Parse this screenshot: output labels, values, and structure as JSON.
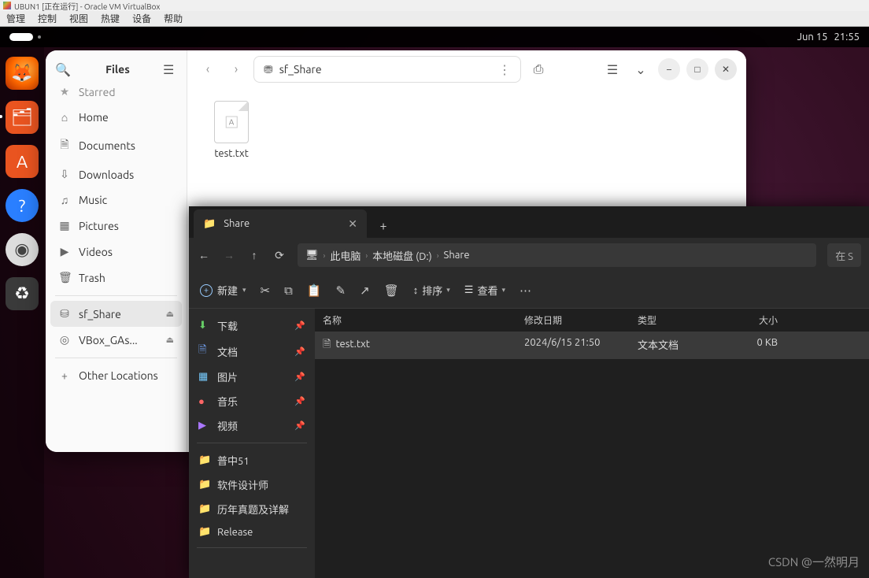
{
  "vbox": {
    "title": "UBUN1 [正在运行] - Oracle VM VirtualBox",
    "menu": [
      "管理",
      "控制",
      "视图",
      "热键",
      "设备",
      "帮助"
    ]
  },
  "topbar": {
    "date": "Jun 15",
    "time": "21:55"
  },
  "nautilus": {
    "sidebar_title": "Files",
    "path_label": "sf_Share",
    "sidebar": [
      {
        "icon": "★",
        "label": "Starred"
      },
      {
        "icon": "⌂",
        "label": "Home"
      },
      {
        "icon": "🗎",
        "label": "Documents"
      },
      {
        "icon": "⇩",
        "label": "Downloads"
      },
      {
        "icon": "♫",
        "label": "Music"
      },
      {
        "icon": "▦",
        "label": "Pictures"
      },
      {
        "icon": "▶",
        "label": "Videos"
      },
      {
        "icon": "🗑",
        "label": "Trash"
      }
    ],
    "mounts": [
      {
        "icon": "⛁",
        "label": "sf_Share",
        "selected": true
      },
      {
        "icon": "◎",
        "label": "VBox_GAs..."
      }
    ],
    "other_locations": "Other Locations",
    "files": [
      {
        "name": "test.txt"
      }
    ]
  },
  "winexp": {
    "tab_title": "Share",
    "breadcrumb": [
      "此电脑",
      "本地磁盘 (D:)",
      "Share"
    ],
    "search_placeholder": "在 S",
    "new_label": "新建",
    "sort_label": "排序",
    "view_label": "查看",
    "columns": {
      "name": "名称",
      "date": "修改日期",
      "type": "类型",
      "size": "大小"
    },
    "side": [
      {
        "icon": "⬇",
        "label": "下载",
        "pin": true,
        "color": "#6c6"
      },
      {
        "icon": "🗎",
        "label": "文档",
        "pin": true,
        "color": "#7af"
      },
      {
        "icon": "▦",
        "label": "图片",
        "pin": true,
        "color": "#7cf"
      },
      {
        "icon": "●",
        "label": "音乐",
        "pin": true,
        "color": "#f66"
      },
      {
        "icon": "▶",
        "label": "视频",
        "pin": true,
        "color": "#a7f"
      },
      {
        "icon": "📁",
        "label": "普中51",
        "color": "#f0c674"
      },
      {
        "icon": "📁",
        "label": "软件设计师",
        "color": "#f0c674"
      },
      {
        "icon": "📁",
        "label": "历年真题及详解",
        "color": "#f0c674"
      },
      {
        "icon": "📁",
        "label": "Release",
        "color": "#f0c674"
      }
    ],
    "rows": [
      {
        "name": "test.txt",
        "date": "2024/6/15 21:50",
        "type": "文本文档",
        "size": "0 KB"
      }
    ]
  },
  "watermark": "CSDN @一然明月"
}
